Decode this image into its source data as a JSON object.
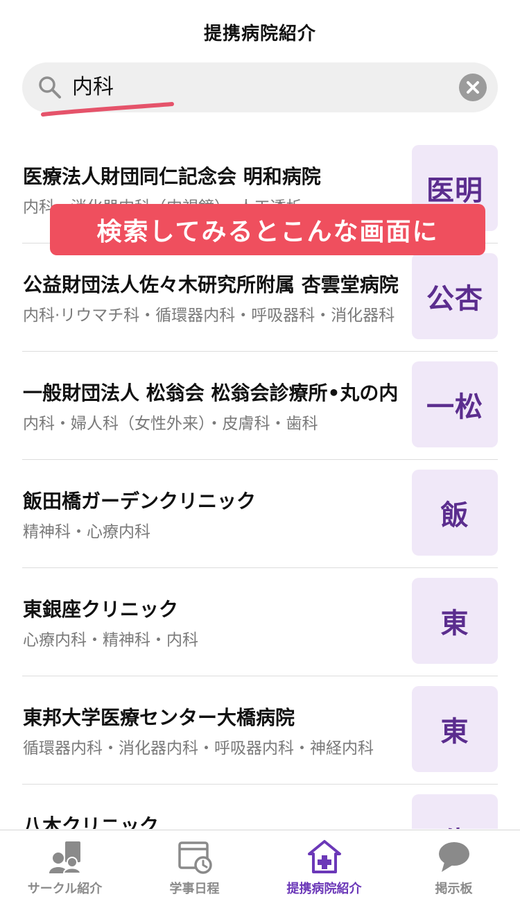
{
  "header": {
    "title": "提携病院紹介"
  },
  "search": {
    "value": "内科",
    "search_icon": "search-icon",
    "clear_icon": "clear-icon"
  },
  "overlay": {
    "text": "検索してみるとこんな画面に"
  },
  "hospitals": [
    {
      "name": "医療法人財団同仁記念会 明和病院",
      "depts": "内科・消化器内科（内視鏡）・人工透析",
      "badge": "医明"
    },
    {
      "name": "公益財団法人佐々木研究所附属 杏雲堂病院",
      "depts": "内科·リウマチ科・循環器内科・呼吸器科・消化器科",
      "badge": "公杏"
    },
    {
      "name": "一般財団法人 松翁会 松翁会診療所•丸の内",
      "depts": "内科・婦人科（女性外来）・皮膚科・歯科",
      "badge": "一松"
    },
    {
      "name": "飯田橋ガーデンクリニック",
      "depts": "精神科・心療内科",
      "badge": "飯"
    },
    {
      "name": "東銀座クリニック",
      "depts": "心療内科・精神科・内科",
      "badge": "東"
    },
    {
      "name": "東邦大学医療センター大橋病院",
      "depts": "循環器内科・消化器内科・呼吸器内科・神経内科",
      "badge": "東"
    },
    {
      "name": "八木クリニック",
      "depts": "",
      "badge": "八"
    }
  ],
  "tabs": [
    {
      "label": "サークル紹介",
      "icon": "circle-members-icon",
      "active": false
    },
    {
      "label": "学事日程",
      "icon": "calendar-clock-icon",
      "active": false
    },
    {
      "label": "提携病院紹介",
      "icon": "hospital-icon",
      "active": true
    },
    {
      "label": "掲示板",
      "icon": "chat-bubble-icon",
      "active": false
    }
  ],
  "colors": {
    "accent_purple": "#6b38b8",
    "badge_bg": "#f0e8f8",
    "badge_text": "#5b2d8e",
    "overlay_red": "#ef4f5e",
    "underline_pink": "#e5536a"
  }
}
